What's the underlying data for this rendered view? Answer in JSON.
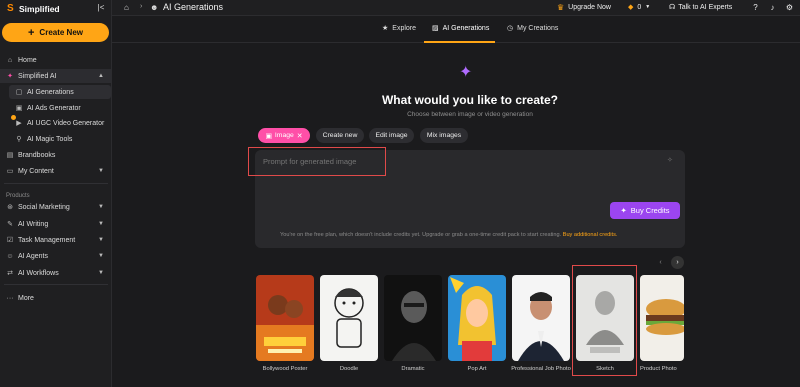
{
  "app": {
    "name": "Simplified",
    "collapse_icon": "sidebar-collapse-icon"
  },
  "sidebar": {
    "create_label": "Create New",
    "items": [
      {
        "label": "Home",
        "icon": "home-icon"
      },
      {
        "label": "Simplified AI",
        "icon": "sparkle-icon",
        "expanded": true
      },
      {
        "label": "AI Generations",
        "icon": "image-gen-icon"
      },
      {
        "label": "AI Ads Generator",
        "icon": "ads-icon"
      },
      {
        "label": "AI UGC Video Generator",
        "icon": "video-icon"
      },
      {
        "label": "AI Magic Tools",
        "icon": "magic-icon"
      },
      {
        "label": "Brandbooks",
        "icon": "book-icon"
      },
      {
        "label": "My Content",
        "icon": "folder-icon"
      }
    ],
    "products_label": "Products",
    "products": [
      {
        "label": "Social Marketing",
        "icon": "share-icon"
      },
      {
        "label": "AI Writing",
        "icon": "pen-icon"
      },
      {
        "label": "Task Management",
        "icon": "tasks-icon"
      },
      {
        "label": "AI Agents",
        "icon": "agent-icon"
      },
      {
        "label": "AI Workflows",
        "icon": "workflow-icon"
      }
    ],
    "more_label": "More"
  },
  "topbar": {
    "title": "AI Generations",
    "upgrade": "Upgrade Now",
    "credits": "0",
    "talk": "Talk to AI Experts"
  },
  "tabs": [
    {
      "label": "Explore",
      "icon": "star-icon"
    },
    {
      "label": "AI Generations",
      "icon": "palette-icon",
      "active": true
    },
    {
      "label": "My Creations",
      "icon": "clock-icon"
    }
  ],
  "hero": {
    "headline": "What would you like to create?",
    "subline": "Choose between image or video generation"
  },
  "chips": {
    "image": "Image",
    "create_new": "Create new",
    "edit_image": "Edit image",
    "mix_images": "Mix images"
  },
  "prompt": {
    "placeholder": "Prompt for generated image",
    "buy_label": "Buy Credits",
    "plan_note": "You're on the free plan, which doesn't include credits yet. Upgrade or grab a one-time credit pack to start creating.",
    "plan_link": "Buy additional credits."
  },
  "gallery": [
    {
      "label": "Bollywood Poster"
    },
    {
      "label": "Doodle"
    },
    {
      "label": "Dramatic"
    },
    {
      "label": "Pop Art"
    },
    {
      "label": "Professional Job Photo"
    },
    {
      "label": "Sketch"
    },
    {
      "label": "Product Photo"
    }
  ],
  "colors": {
    "accent": "#ffa515",
    "pink": "#ff4fa8",
    "purple": "#9b45f0",
    "highlight": "#e04a4a"
  }
}
